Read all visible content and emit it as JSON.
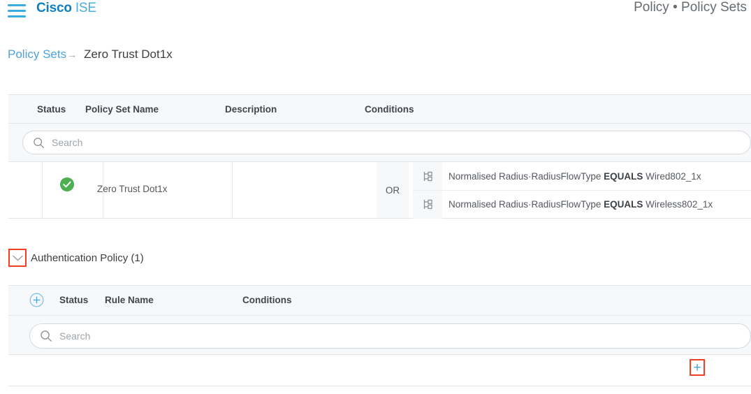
{
  "header": {
    "menu_icon": "hamburger-menu-icon",
    "brand_primary": "Cisco",
    "brand_secondary": "ISE",
    "context_path": "Policy • Policy Sets"
  },
  "breadcrumb": {
    "link_label": "Policy Sets",
    "arrow": "→",
    "current_label": "Zero Trust Dot1x"
  },
  "policy_set_table": {
    "columns": {
      "status": "Status",
      "name": "Policy Set Name",
      "description": "Description",
      "conditions": "Conditions"
    },
    "search": {
      "placeholder": "Search",
      "value": ""
    },
    "row": {
      "status_icon": "green-check-circle-icon",
      "name": "Zero Trust Dot1x",
      "description": "",
      "operator": "OR",
      "conditions": [
        {
          "icon": "condition-branch-icon",
          "attribute": "Normalised Radius·RadiusFlowType",
          "operator": "EQUALS",
          "value": "Wired802_1x"
        },
        {
          "icon": "condition-branch-icon",
          "attribute": "Normalised Radius·RadiusFlowType",
          "operator": "EQUALS",
          "value": "Wireless802_1x"
        }
      ]
    }
  },
  "authentication_policy": {
    "toggle_icon": "chevron-down-icon",
    "title": "Authentication Policy (1)",
    "columns": {
      "status": "Status",
      "rule_name": "Rule Name",
      "conditions": "Conditions"
    },
    "add_column_icon": "plus-circle-icon",
    "search": {
      "placeholder": "Search",
      "value": ""
    },
    "add_rule_icon": "plus-icon"
  },
  "colors": {
    "brand_blue": "#0d7fc0",
    "link_blue": "#4aa3dd",
    "status_green": "#4caf50",
    "highlight_red": "#f04124",
    "header_bg": "#f7f8f9",
    "border": "#e3e5e8"
  }
}
